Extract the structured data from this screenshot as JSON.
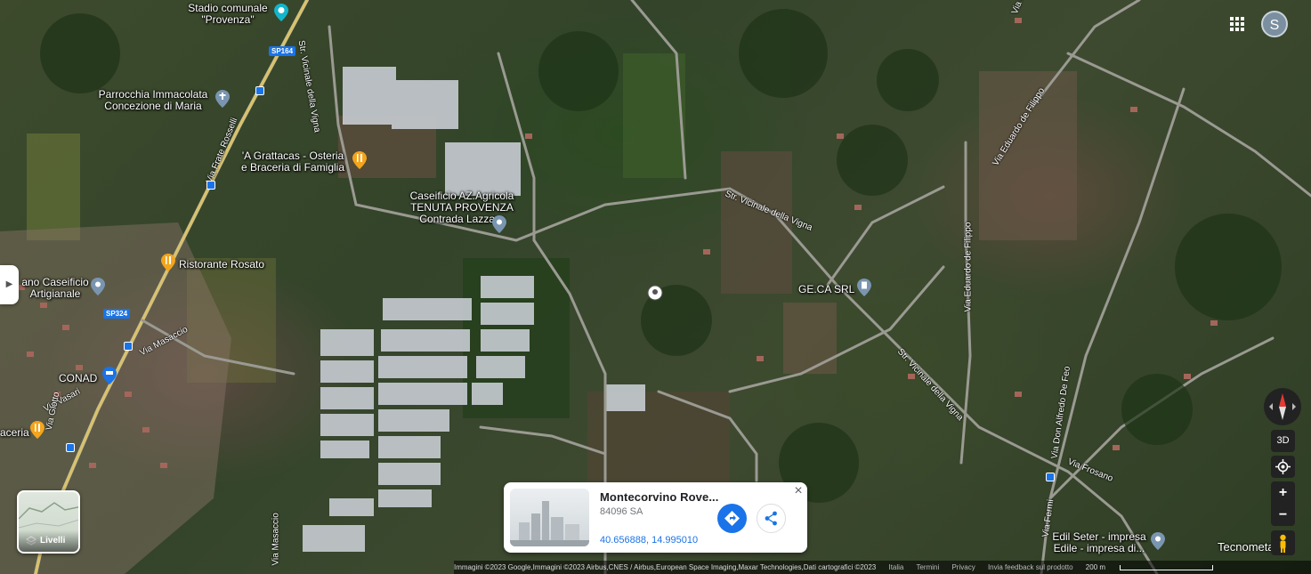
{
  "top_bar": {
    "avatar_initial": "S",
    "apps_icon": "grid-apps-icon"
  },
  "places": {
    "stadio": "Stadio comunale\n\"Provenza\"",
    "stadio_line1": "Stadio comunale",
    "stadio_line2": "\"Provenza\"",
    "parrocchia_line1": "Parrocchia Immacolata",
    "parrocchia_line2": "Concezione di Maria",
    "grattacas_line1": "'A Grattacas - Osteria",
    "grattacas_line2": "e Braceria di Famiglia",
    "caseificio_line1": "Caseificio AZ.Agricola",
    "caseificio_line2": "TENUTA PROVENZA",
    "caseificio_line3": "Contrada Lazzaro",
    "ristorante": "Ristorante Rosato",
    "caseificio_art_line1": "ano Caseificio",
    "caseificio_art_line2": "Artigianale",
    "conad": "CONAD",
    "braceria": "aceria",
    "gecasrl": "GE.CA SRL",
    "edil_line1": "Edil Seter - impresa",
    "edil_line2": "Edile - impresa di...",
    "tecnomet": "Tecnometa"
  },
  "roads": {
    "str_vicinale_vigna_1": "Str. Vicinale della Vigna",
    "str_vicinale_vigna_2": "Str. Vicinale della Vigna",
    "str_vicinale_vigna_3": "Str. Vicinale della Vigna",
    "via_frate_rosselli": "Via Frate Rosselli",
    "via_eduardo_de_filippo_1": "Via Eduardo de Filippo",
    "via_eduardo_de_filippo_2": "Via Eduardo de Filippo",
    "via_masaccio_1": "Via Masaccio",
    "via_masaccio_2": "Via Masaccio",
    "via_vasari": "Via Vasari",
    "via_giotto": "Via Giotto",
    "via_don_alfredo_feo": "Via Don Alfredo De Feo",
    "via_frosano": "Via Frosano",
    "via_fermi": "Via Fermi",
    "via_milano": "Via Milano",
    "route_sp164": "SP164",
    "route_sp324": "SP324"
  },
  "layers_button": {
    "label": "Livelli",
    "icon": "layers-icon"
  },
  "controls": {
    "three_d": "3D",
    "zoom_in": "+",
    "zoom_out": "−",
    "compass_icon": "compass-icon",
    "my_location_icon": "my-location-icon",
    "pegman_icon": "pegman-icon"
  },
  "place_card": {
    "title": "Montecorvino Rove...",
    "subtitle": "84096 SA",
    "coords": "40.656888, 14.995010",
    "close": "×",
    "directions_icon": "directions-icon",
    "share_icon": "share-icon"
  },
  "footer": {
    "attribution": "Immagini ©2023 Google,Immagini ©2023 Airbus,CNES / Airbus,European Space Imaging,Maxar Technologies,Dati cartografici ©2023",
    "italia": "Italia",
    "termini": "Termini",
    "privacy": "Privacy",
    "feedback": "Invia feedback sul prodotto",
    "scale": "200 m"
  },
  "colors": {
    "accent": "#1a73e8",
    "pin_orange": "#f4a51c",
    "pin_blue_gray": "#7a95b0",
    "pin_teal": "#12b5cb"
  }
}
